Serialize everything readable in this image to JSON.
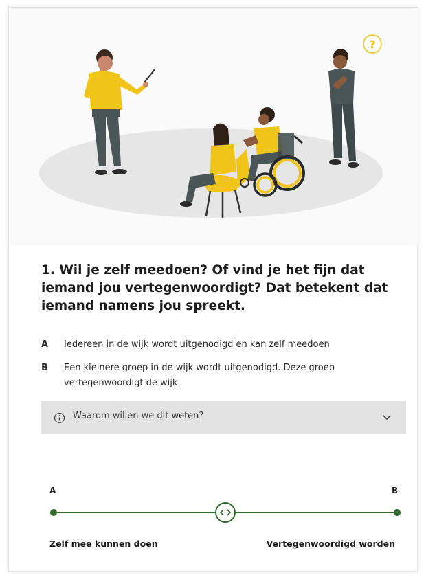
{
  "question": {
    "text": "1. Wil je zelf meedoen? Of vind je het fijn dat iemand jou vertegenwoordigt? Dat betekent dat iemand namens jou spreekt."
  },
  "options": [
    {
      "letter": "A",
      "text": "Iedereen in de wijk wordt uitgenodigd en kan zelf meedoen"
    },
    {
      "letter": "B",
      "text": "Een kleinere groep in de wijk wordt uitgenodigd. Deze groep vertegenwoordigt de wijk"
    }
  ],
  "accordion": {
    "label": "Waarom willen we dit weten?",
    "icon": "info-circle-icon",
    "chevron": "chevron-down-icon"
  },
  "scale": {
    "left_letter": "A",
    "right_letter": "B",
    "left_label": "Zelf mee kunnen doen",
    "right_label": "Vertegenwoordigd worden",
    "value": 0.5,
    "handle_icon": "left-right-arrows-icon"
  },
  "illustration": {
    "bubble_text": "?"
  },
  "colors": {
    "slider_green": "#2f6b2f",
    "accent_yellow": "#f0c419",
    "accordion_bg": "#e3e3e3",
    "text": "#1d1d1d"
  }
}
